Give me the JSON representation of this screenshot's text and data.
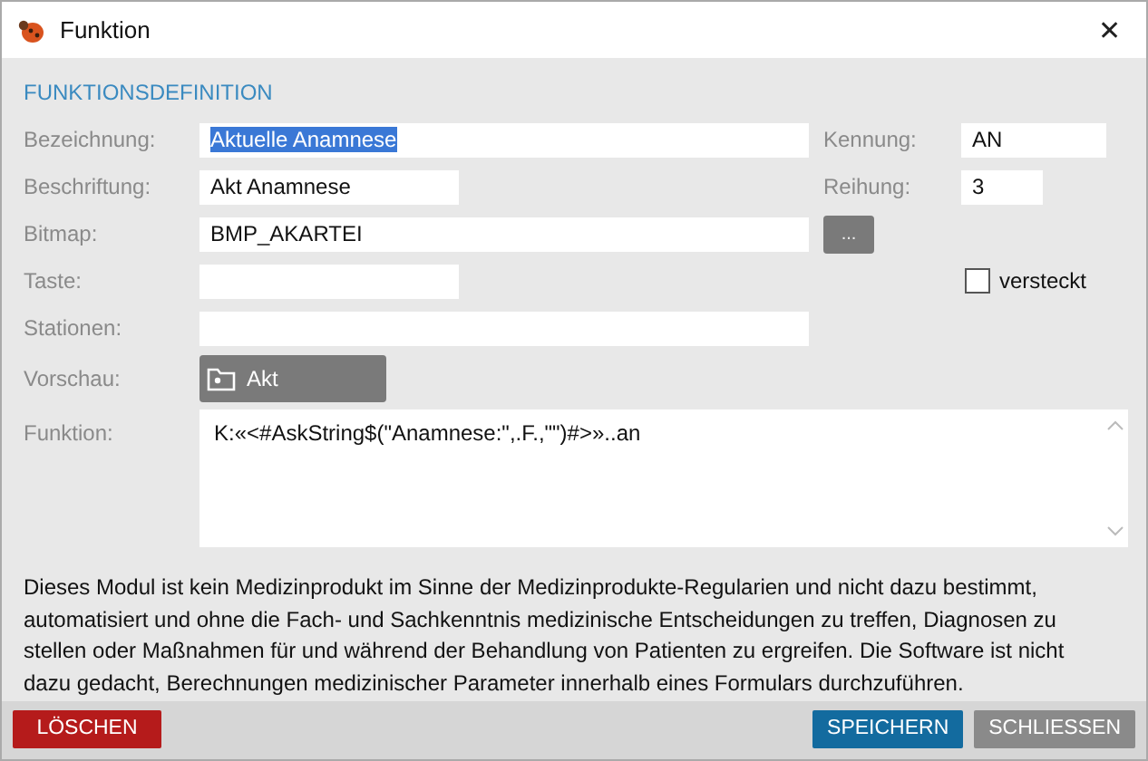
{
  "window": {
    "title": "Funktion",
    "close": "✕"
  },
  "section_title": "FUNKTIONSDEFINITION",
  "bezeichnung": {
    "label": "Bezeichnung:",
    "value": "Aktuelle Anamnese",
    "value_selected": true
  },
  "kennung": {
    "label": "Kennung:",
    "value": "AN"
  },
  "beschriftung": {
    "label": "Beschriftung:",
    "value": "Akt Anamnese"
  },
  "reihung": {
    "label": "Reihung:",
    "value": "3"
  },
  "bitmap": {
    "label": "Bitmap:",
    "value": "BMP_AKARTEI",
    "button": "..."
  },
  "taste": {
    "label": "Taste:"
  },
  "versteckt": {
    "label": "versteckt",
    "checked": false
  },
  "stationen": {
    "label": "Stationen:"
  },
  "vorschau": {
    "label": "Vorschau:",
    "button": "Akt"
  },
  "funktion": {
    "label": "Funktion:",
    "value": "K:«<#AskString$(\"Anamnese:\",.F.,\"\")#>»..an"
  },
  "disclaimer": "Dieses Modul ist kein Medizinprodukt im Sinne der Medizinprodukte-Regularien und nicht dazu bestimmt, automatisiert und ohne die Fach- und Sachkenntnis medizinische Entscheidungen zu treffen, Diagnosen zu stellen oder Maßnahmen für und während der Behandlung von Patienten zu ergreifen. Die Software ist nicht dazu gedacht, Berechnungen medizinischer Parameter innerhalb eines Formulars durchzuführen.",
  "buttons": [
    {
      "label": "LÖSCHEN",
      "kind": "danger"
    },
    {
      "label": "SPEICHERN",
      "kind": "primary"
    },
    {
      "label": "SCHLIESSEN",
      "kind": "secondary"
    }
  ]
}
